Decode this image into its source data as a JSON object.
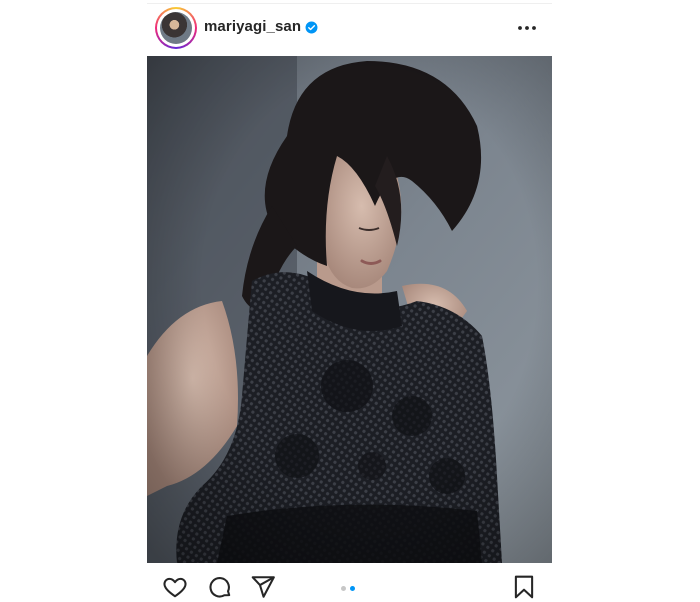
{
  "post": {
    "username": "mariyagi_san",
    "verified": true,
    "carousel": {
      "total": 2,
      "active_index": 2
    }
  },
  "icons": {
    "verified": "verified-badge-icon",
    "more": "more-options-icon",
    "like": "heart-icon",
    "comment": "comment-bubble-icon",
    "share": "paper-plane-icon",
    "save": "bookmark-icon"
  },
  "colors": {
    "verified_blue": "#0095f6",
    "active_dot": "#0095f6",
    "inactive_dot": "#c7c7c7",
    "text": "#262626"
  }
}
